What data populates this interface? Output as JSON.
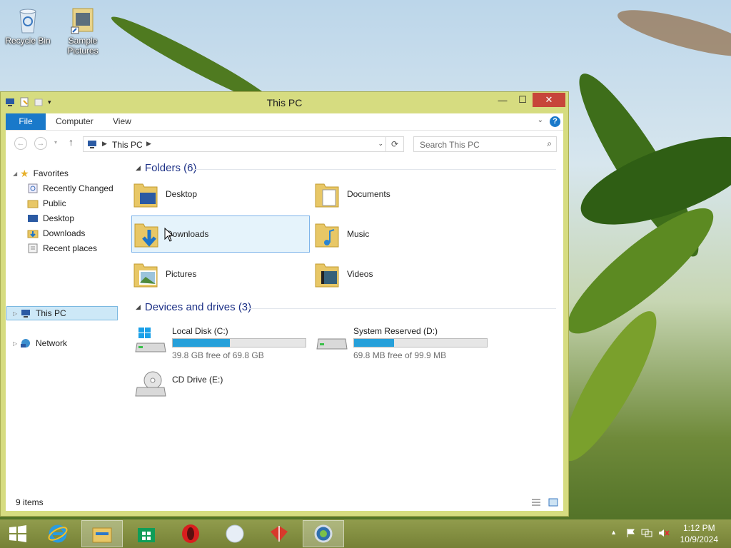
{
  "desktop": {
    "icons": [
      {
        "label": "Recycle Bin",
        "icon": "recycle-bin-icon"
      },
      {
        "label": "Sample Pictures",
        "icon": "folder-shortcut-icon"
      }
    ]
  },
  "window": {
    "title": "This PC",
    "ribbon": {
      "file_tab": "File",
      "tabs": [
        "Computer",
        "View"
      ]
    },
    "address": {
      "location": "This PC"
    },
    "search": {
      "placeholder": "Search This PC"
    },
    "nav": {
      "favorites_label": "Favorites",
      "favorites": [
        "Recently Changed",
        "Public",
        "Desktop",
        "Downloads",
        "Recent places"
      ],
      "this_pc": "This PC",
      "network": "Network"
    },
    "folders": {
      "header": "Folders (6)",
      "items": [
        "Desktop",
        "Documents",
        "Downloads",
        "Music",
        "Pictures",
        "Videos"
      ],
      "selected": "Downloads"
    },
    "drives": {
      "header": "Devices and drives (3)",
      "items": [
        {
          "name": "Local Disk (C:)",
          "free": "39.8 GB free of 69.8 GB",
          "used_fraction": 0.43
        },
        {
          "name": "System Reserved (D:)",
          "free": "69.8 MB free of 99.9 MB",
          "used_fraction": 0.3
        },
        {
          "name": "CD Drive (E:)"
        }
      ]
    },
    "status": "9 items"
  },
  "taskbar": {
    "clock": {
      "time": "1:12 PM",
      "date": "10/9/2024"
    },
    "colors": {
      "accent": "#1979ca",
      "close": "#c7453a",
      "drive_fill": "#26a0da"
    }
  }
}
